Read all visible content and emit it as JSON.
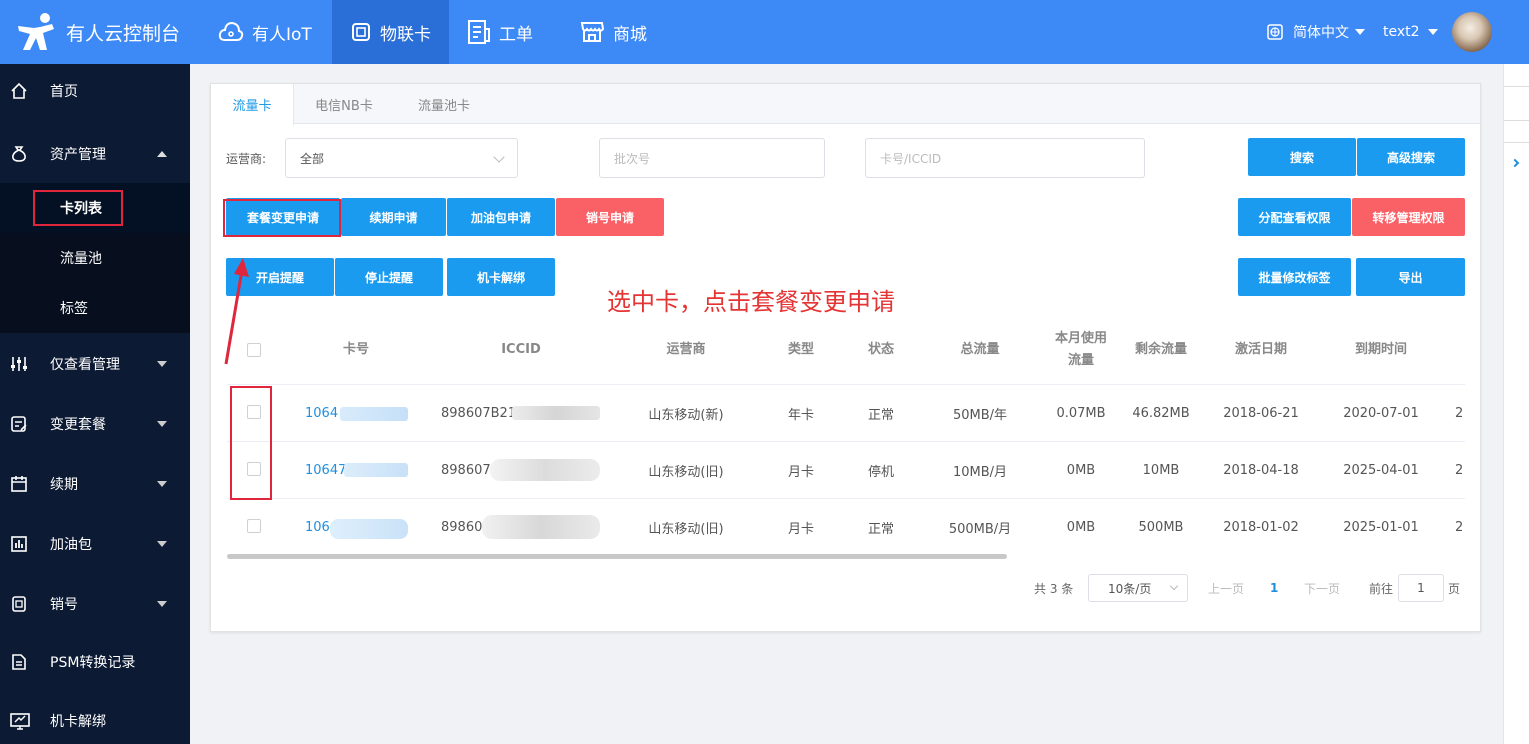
{
  "header": {
    "logo_text": "有人云控制台",
    "nav": [
      {
        "label": "有人IoT",
        "icon": "cloud-icon"
      },
      {
        "label": "物联卡",
        "icon": "sim-card-icon",
        "active": true
      },
      {
        "label": "工单",
        "icon": "document-icon"
      },
      {
        "label": "商城",
        "icon": "store-icon"
      }
    ],
    "language": "简体中文",
    "user": "text2",
    "brand_color": "#3d8af7"
  },
  "sidebar": {
    "items": [
      {
        "label": "首页",
        "icon": "home-icon"
      },
      {
        "label": "资产管理",
        "icon": "money-bag-icon",
        "expanded": true
      },
      {
        "label": "卡列表",
        "sub": true,
        "active": true
      },
      {
        "label": "流量池",
        "sub": true
      },
      {
        "label": "标签",
        "sub": true
      },
      {
        "label": "仅查看管理",
        "icon": "sliders-icon"
      },
      {
        "label": "变更套餐",
        "icon": "edit-icon"
      },
      {
        "label": "续期",
        "icon": "calendar-icon"
      },
      {
        "label": "加油包",
        "icon": "bar-chart-icon"
      },
      {
        "label": "销号",
        "icon": "sim-icon"
      },
      {
        "label": "PSM转换记录",
        "icon": "file-icon"
      },
      {
        "label": "机卡解绑",
        "icon": "monitor-icon"
      }
    ]
  },
  "tabs": [
    "流量卡",
    "电信NB卡",
    "流量池卡"
  ],
  "filters": {
    "operator_label": "运营商:",
    "operator_value": "全部",
    "batch_placeholder": "批次号",
    "card_placeholder": "卡号/ICCID",
    "search_btn": "搜索",
    "advanced_btn": "高级搜索"
  },
  "actions": {
    "row1": [
      "套餐变更申请",
      "续期申请",
      "加油包申请",
      "销号申请"
    ],
    "row1_right": [
      "分配查看权限",
      "转移管理权限"
    ],
    "row2": [
      "开启提醒",
      "停止提醒",
      "机卡解绑"
    ],
    "row2_right": [
      "批量修改标签",
      "导出"
    ]
  },
  "annotation": "选中卡，点击套餐变更申请",
  "table": {
    "headers": [
      "卡号",
      "ICCID",
      "运营商",
      "类型",
      "状态",
      "总流量",
      "本月使用流量",
      "剩余流量",
      "激活日期",
      "到期时间"
    ],
    "header_usage_line1": "本月使用",
    "header_usage_line2": "流量",
    "rows": [
      {
        "card": "1064",
        "iccid": "898607B21",
        "operator": "山东移动(新)",
        "type": "年卡",
        "status": "正常",
        "total": "50MB/年",
        "used": "0.07MB",
        "remain": "46.82MB",
        "activated": "2018-06-21",
        "expires": "2020-07-01",
        "extra": "2"
      },
      {
        "card": "10647",
        "iccid": "898607",
        "operator": "山东移动(旧)",
        "type": "月卡",
        "status": "停机",
        "total": "10MB/月",
        "used": "0MB",
        "remain": "10MB",
        "activated": "2018-04-18",
        "expires": "2025-04-01",
        "extra": "2"
      },
      {
        "card": "106",
        "iccid": "89860",
        "operator": "山东移动(旧)",
        "type": "月卡",
        "status": "正常",
        "total": "500MB/月",
        "used": "0MB",
        "remain": "500MB",
        "activated": "2018-01-02",
        "expires": "2025-01-01",
        "extra": "2"
      }
    ]
  },
  "pagination": {
    "total": "共 3 条",
    "page_size": "10条/页",
    "prev": "上一页",
    "current": "1",
    "next": "下一页",
    "goto": "前往",
    "goto_value": "1",
    "page_suffix": "页"
  }
}
